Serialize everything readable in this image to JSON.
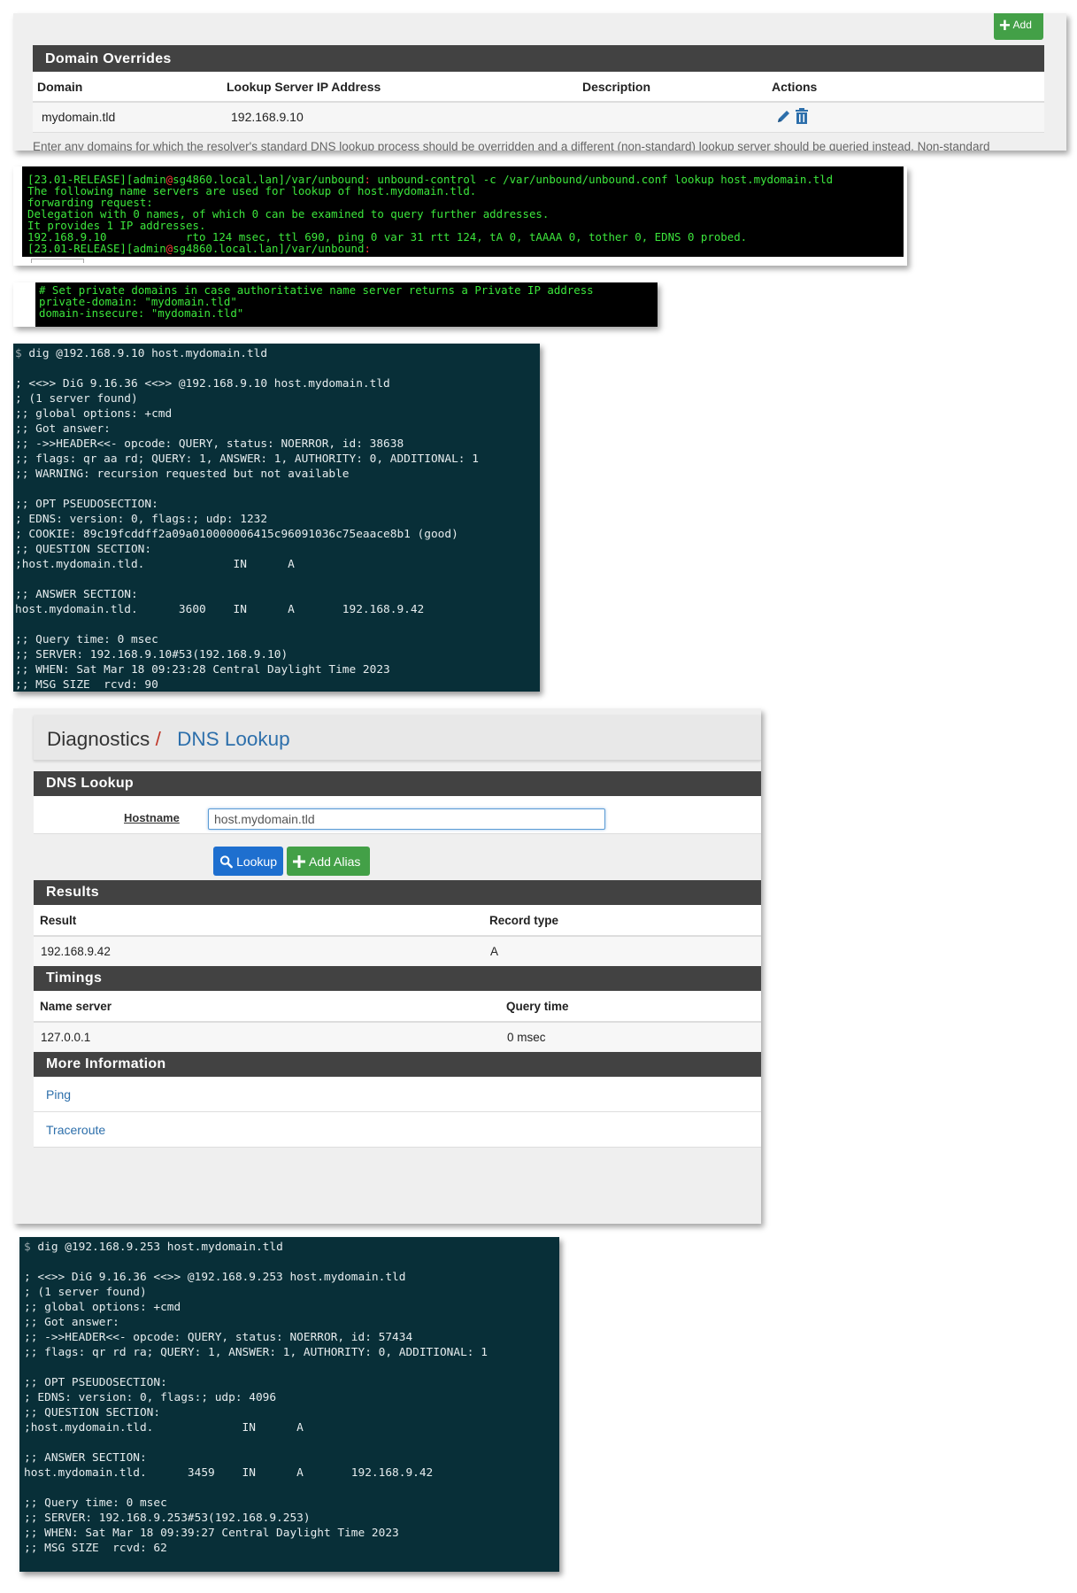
{
  "domain_overrides": {
    "add_label": "Add",
    "title": "Domain Overrides",
    "columns": [
      "Domain",
      "Lookup Server IP Address",
      "Description",
      "Actions"
    ],
    "rows": [
      {
        "domain": "mydomain.tld",
        "lookup_ip": "192.168.9.10",
        "description": ""
      }
    ],
    "note": "Enter any domains for which the resolver's standard DNS lookup process should be overridden and a different (non-standard) lookup server should be queried instead. Non-standard"
  },
  "terminal1": {
    "prompt_prefix": "[23.01-RELEASE][admin",
    "prompt_at": "@",
    "prompt_host": "sg4860.local.lan]/var/unbound",
    "prompt_colon": ":",
    "command": " unbound-control -c /var/unbound/unbound.conf lookup host.mydomain.tld",
    "output": "The following name servers are used for lookup of host.mydomain.tld.\nforwarding request:\nDelegation with 0 names, of which 0 can be examined to query further addresses.\nIt provides 1 IP addresses.\n192.168.9.10            rto 124 msec, ttl 690, ping 0 var 31 rtt 124, tA 0, tAAAA 0, tother 0, EDNS 0 probed.",
    "final_prompt_prefix": "[23.01-RELEASE][admin",
    "final_prompt_host": "sg4860.local.lan]/var/unbound"
  },
  "terminal2": {
    "text": "# Set private domains in case authoritative name server returns a Private IP address\nprivate-domain: \"mydomain.tld\"\ndomain-insecure: \"mydomain.tld\""
  },
  "dig1": {
    "prompt": "$",
    "command": " dig @192.168.9.10 host.mydomain.tld",
    "output": "\n; <<>> DiG 9.16.36 <<>> @192.168.9.10 host.mydomain.tld\n; (1 server found)\n;; global options: +cmd\n;; Got answer:\n;; ->>HEADER<<- opcode: QUERY, status: NOERROR, id: 38638\n;; flags: qr aa rd; QUERY: 1, ANSWER: 1, AUTHORITY: 0, ADDITIONAL: 1\n;; WARNING: recursion requested but not available\n\n;; OPT PSEUDOSECTION:\n; EDNS: version: 0, flags:; udp: 1232\n; COOKIE: 89c19fcddff2a09a010000006415c96091036c75eaace8b1 (good)\n;; QUESTION SECTION:\n;host.mydomain.tld.             IN      A\n\n;; ANSWER SECTION:\nhost.mydomain.tld.      3600    IN      A       192.168.9.42\n\n;; Query time: 0 msec\n;; SERVER: 192.168.9.10#53(192.168.9.10)\n;; WHEN: Sat Mar 18 09:23:28 Central Daylight Time 2023\n;; MSG SIZE  rcvd: 90"
  },
  "dns_lookup": {
    "breadcrumb_parent": "Diagnostics",
    "breadcrumb_sep": "/",
    "breadcrumb_current": "DNS Lookup",
    "section_title": "DNS Lookup",
    "hostname_label": "Hostname",
    "hostname_value": "host.mydomain.tld",
    "lookup_button": "Lookup",
    "add_alias_button": "Add Alias",
    "results": {
      "title": "Results",
      "col_result": "Result",
      "col_type": "Record type",
      "row_result": "192.168.9.42",
      "row_type": "A"
    },
    "timings": {
      "title": "Timings",
      "col_server": "Name server",
      "col_time": "Query time",
      "row_server": "127.0.0.1",
      "row_time": "0 msec"
    },
    "more_info": {
      "title": "More Information",
      "links": [
        "Ping",
        "Traceroute"
      ]
    }
  },
  "dig2": {
    "prompt": "$",
    "command": " dig @192.168.9.253 host.mydomain.tld",
    "output": "\n; <<>> DiG 9.16.36 <<>> @192.168.9.253 host.mydomain.tld\n; (1 server found)\n;; global options: +cmd\n;; Got answer:\n;; ->>HEADER<<- opcode: QUERY, status: NOERROR, id: 57434\n;; flags: qr rd ra; QUERY: 1, ANSWER: 1, AUTHORITY: 0, ADDITIONAL: 1\n\n;; OPT PSEUDOSECTION:\n; EDNS: version: 0, flags:; udp: 4096\n;; QUESTION SECTION:\n;host.mydomain.tld.             IN      A\n\n;; ANSWER SECTION:\nhost.mydomain.tld.      3459    IN      A       192.168.9.42\n\n;; Query time: 0 msec\n;; SERVER: 192.168.9.253#53(192.168.9.253)\n;; WHEN: Sat Mar 18 09:39:27 Central Daylight Time 2023\n;; MSG SIZE  rcvd: 62"
  },
  "colors": {
    "panel_bar": "#424242",
    "link": "#2d6fab",
    "lookup_button": "#1e6fcf",
    "add_button": "#43a047",
    "terminal_green": "#3ce63c",
    "dig_background": "#082f38"
  },
  "icons": {
    "edit": "pencil-icon",
    "delete": "trash-icon",
    "search": "search-icon",
    "add": "plus-icon"
  }
}
